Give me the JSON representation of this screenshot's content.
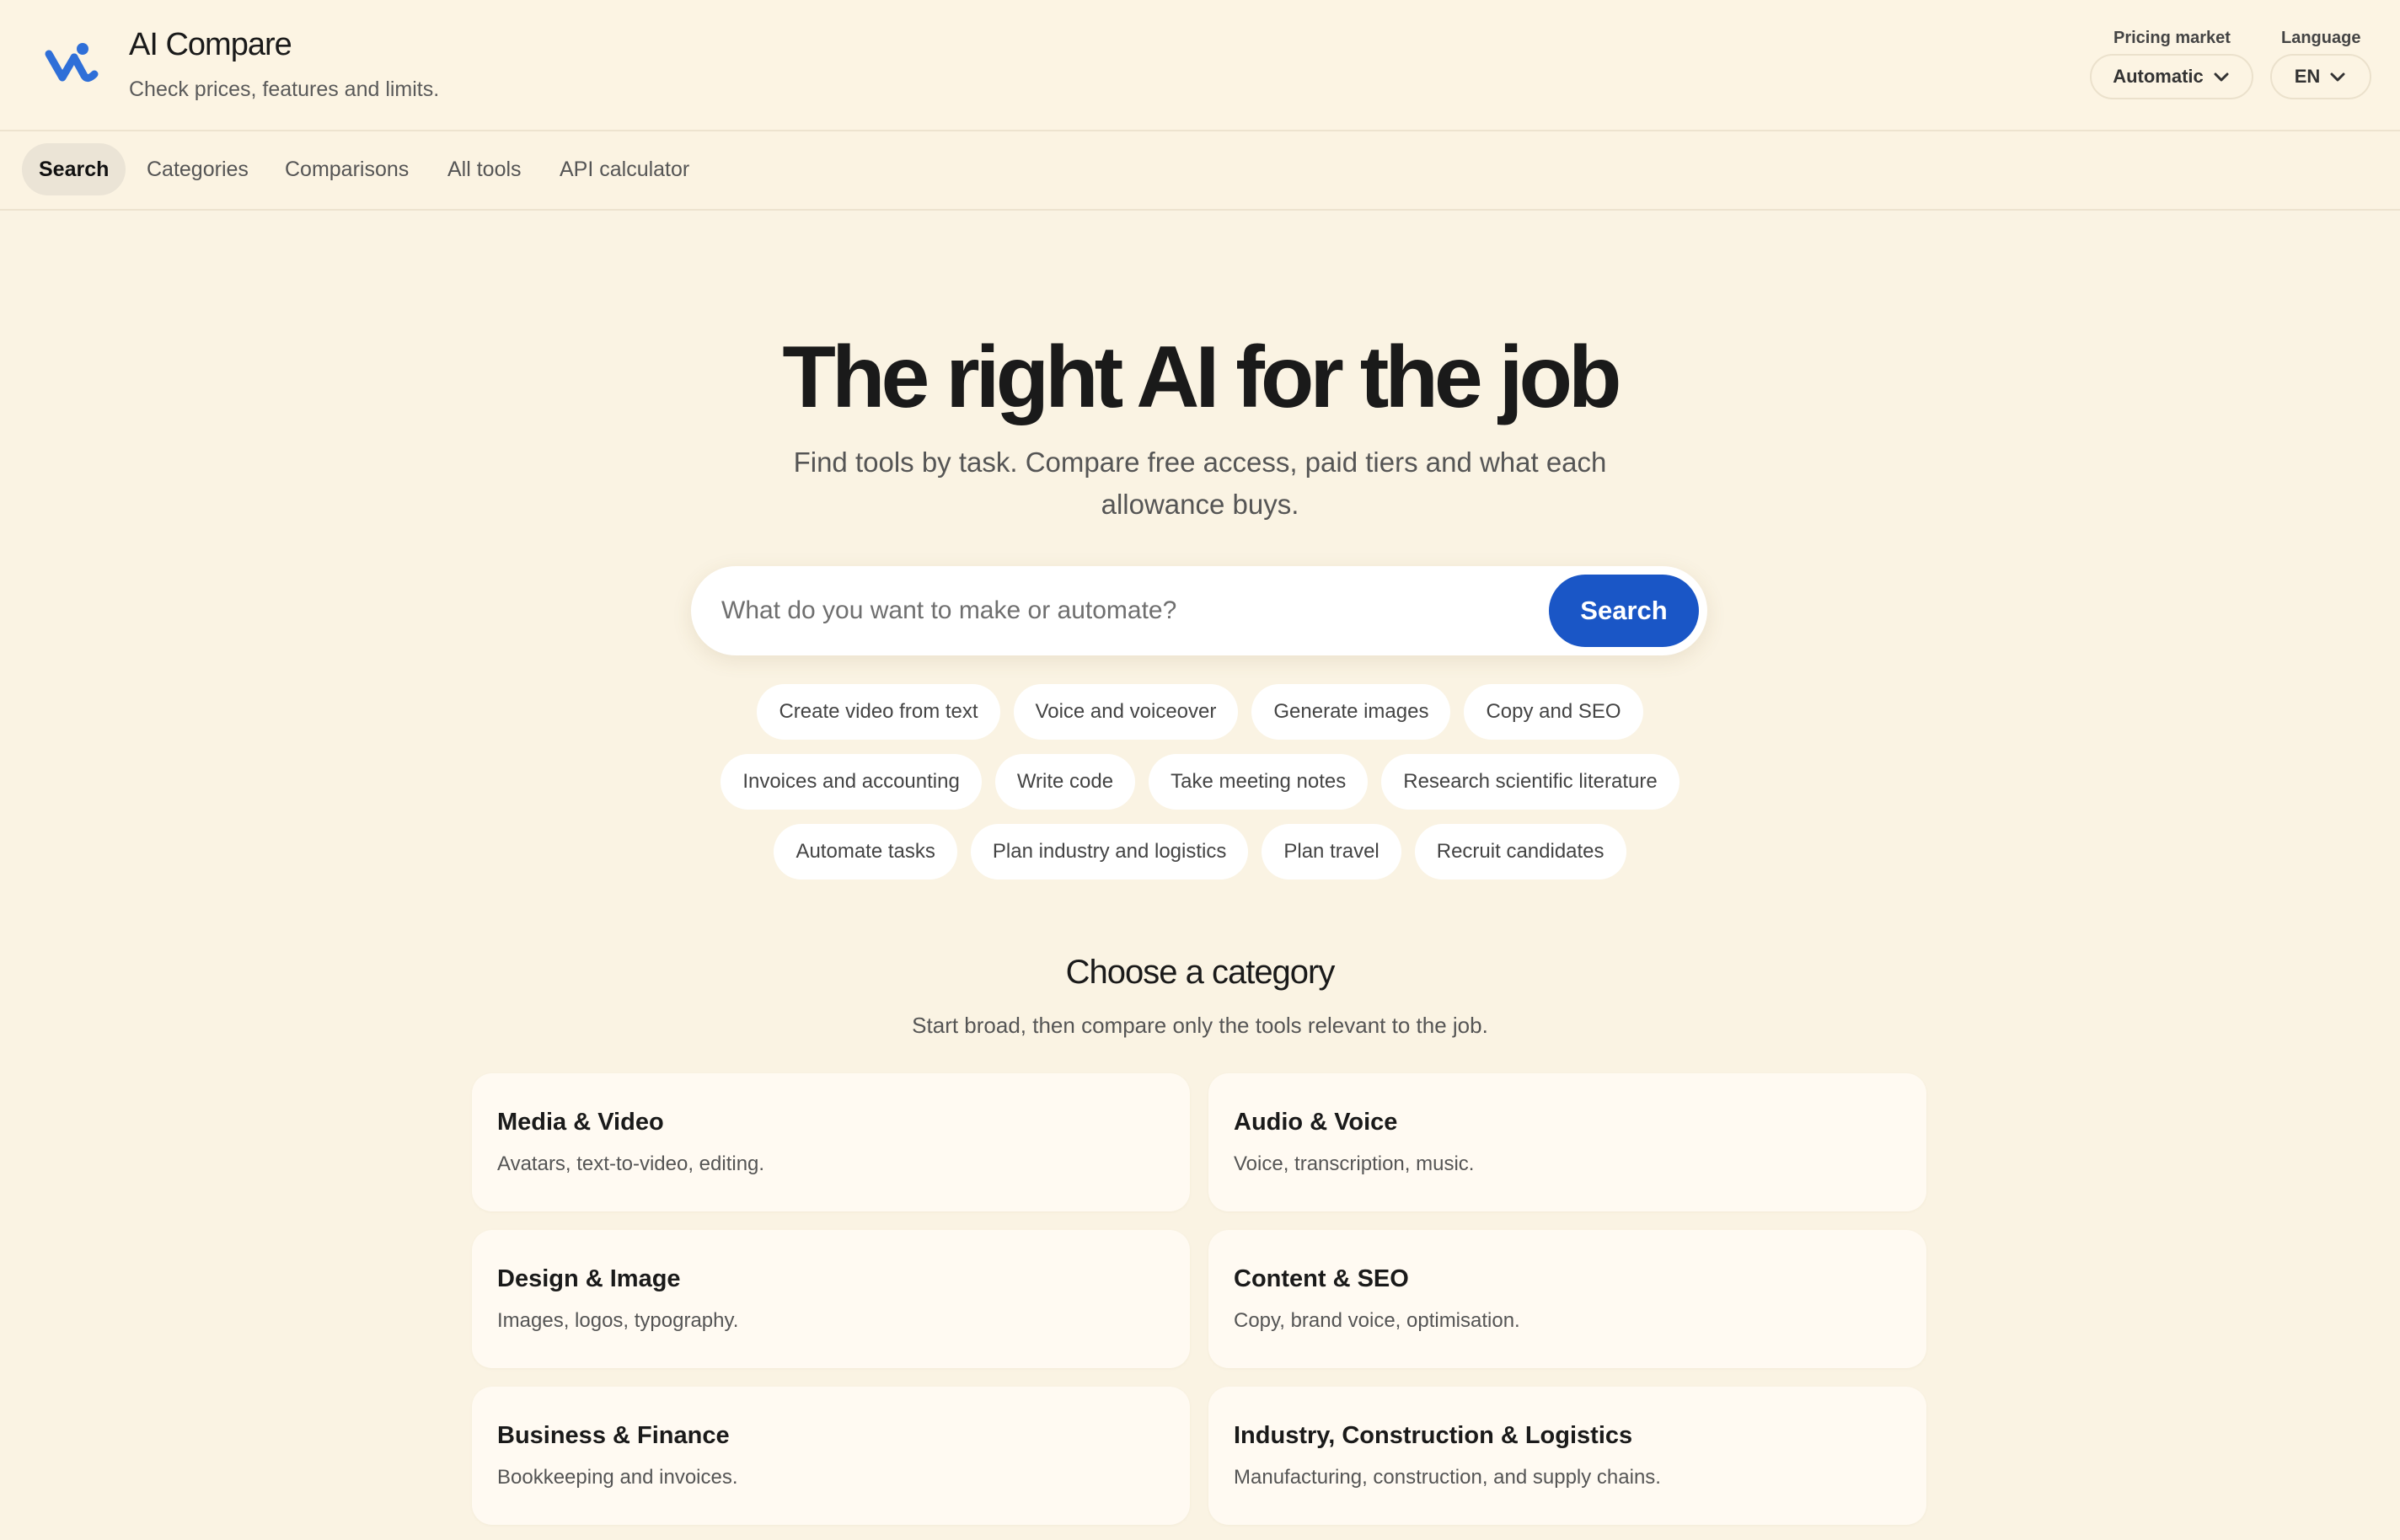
{
  "header": {
    "title": "AI Compare",
    "subtitle": "Check prices, features and limits.",
    "pricing_market": {
      "label": "Pricing market",
      "value": "Automatic"
    },
    "language": {
      "label": "Language",
      "value": "EN"
    },
    "brand_color": "#2f6fd8"
  },
  "nav": {
    "items": [
      {
        "label": "Search",
        "active": true
      },
      {
        "label": "Categories",
        "active": false
      },
      {
        "label": "Comparisons",
        "active": false
      },
      {
        "label": "All tools",
        "active": false
      },
      {
        "label": "API calculator",
        "active": false
      }
    ]
  },
  "hero": {
    "title": "The right AI for the job",
    "subtitle": "Find tools by task. Compare free access, paid tiers and what each allowance buys.",
    "search_placeholder": "What do you want to make or automate?",
    "search_button": "Search",
    "accent_color": "#1a56c6"
  },
  "suggestions": [
    [
      "Create video from text",
      "Voice and voiceover",
      "Generate images",
      "Copy and SEO"
    ],
    [
      "Invoices and accounting",
      "Write code",
      "Take meeting notes",
      "Research scientific literature"
    ],
    [
      "Automate tasks",
      "Plan industry and logistics",
      "Plan travel",
      "Recruit candidates"
    ]
  ],
  "categories": {
    "title": "Choose a category",
    "subtitle": "Start broad, then compare only the tools relevant to the job.",
    "items": [
      {
        "name": "Media & Video",
        "desc": "Avatars, text-to-video, editing."
      },
      {
        "name": "Audio & Voice",
        "desc": "Voice, transcription, music."
      },
      {
        "name": "Design & Image",
        "desc": "Images, logos, typography."
      },
      {
        "name": "Content & SEO",
        "desc": "Copy, brand voice, optimisation."
      },
      {
        "name": "Business & Finance",
        "desc": "Bookkeeping and invoices."
      },
      {
        "name": "Industry, Construction & Logistics",
        "desc": "Manufacturing, construction, and supply chains."
      }
    ]
  }
}
